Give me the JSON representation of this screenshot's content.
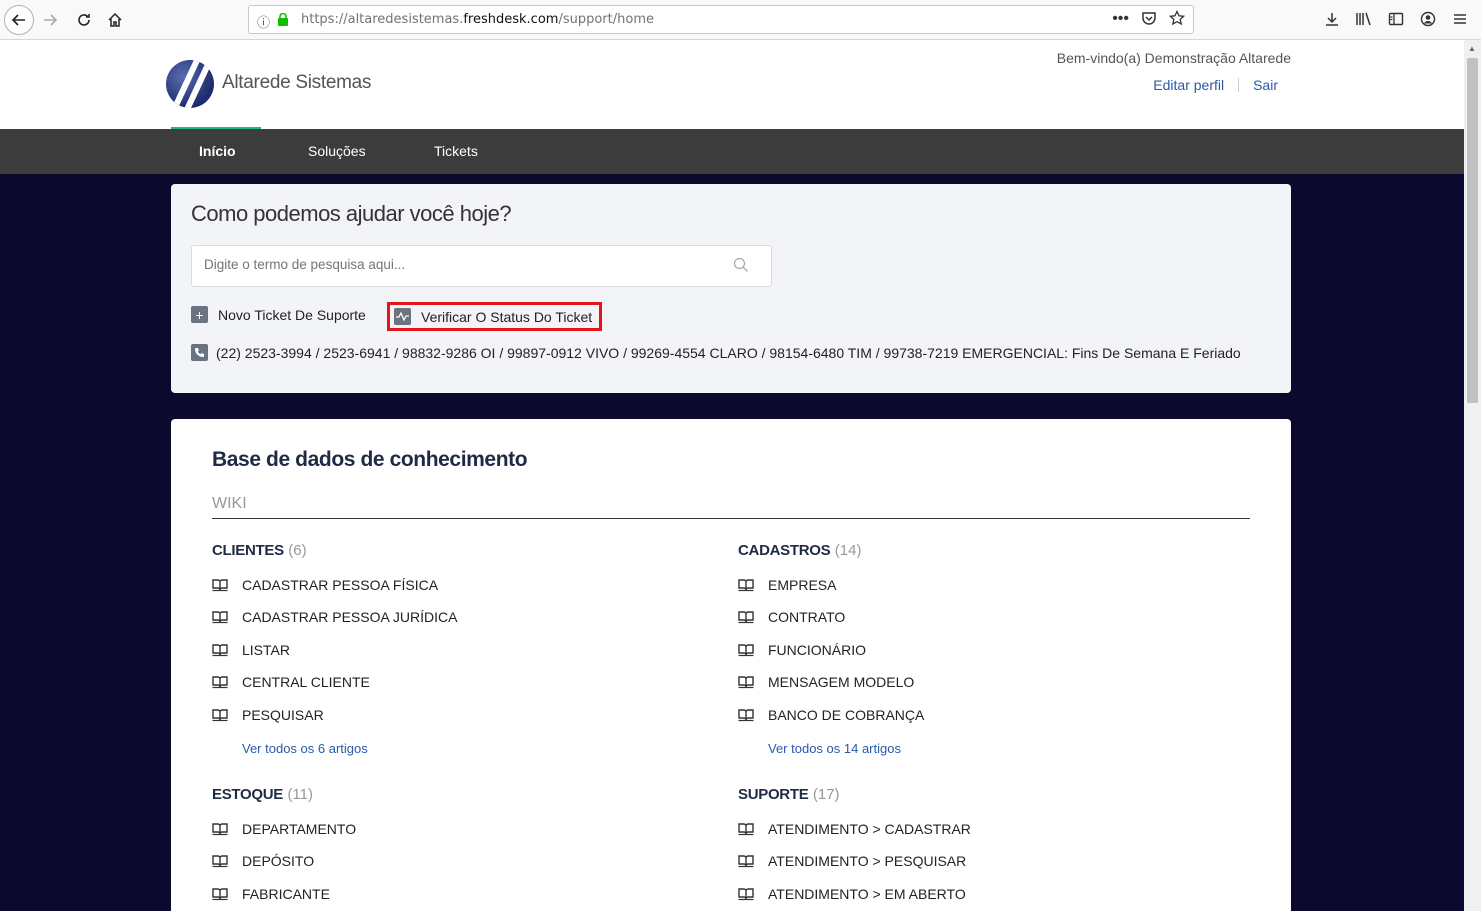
{
  "browser": {
    "url_prefix": "https://altaredesistemas.",
    "url_domain": "freshdesk.com",
    "url_path": "/support/home"
  },
  "header": {
    "logo_text": "Altarede Sistemas",
    "welcome": "Bem-vindo(a) Demonstração Altarede",
    "edit_profile": "Editar perfil",
    "logout": "Sair"
  },
  "nav": {
    "items": [
      "Início",
      "Soluções",
      "Tickets"
    ]
  },
  "help": {
    "title": "Como podemos ajudar você hoje?",
    "search_placeholder": "Digite o termo de pesquisa aqui...",
    "new_ticket": "Novo Ticket De Suporte",
    "check_status": "Verificar O Status Do Ticket",
    "phone": "(22) 2523-3994 / 2523-6941 / 98832-9286 OI / 99897-0912 VIVO / 99269-4554 CLARO / 98154-6480 TIM / 99738-7219 EMERGENCIAL: Fins De Semana E Feriado"
  },
  "kb": {
    "title": "Base de dados de conhecimento",
    "subtitle": "WIKI",
    "categories": [
      {
        "name": "CLIENTES",
        "count": "(6)",
        "articles": [
          "CADASTRAR PESSOA FÍSICA",
          "CADASTRAR PESSOA JURÍDICA",
          "LISTAR",
          "CENTRAL CLIENTE",
          "PESQUISAR"
        ],
        "view_all": "Ver todos os 6 artigos"
      },
      {
        "name": "CADASTROS",
        "count": "(14)",
        "articles": [
          "EMPRESA",
          "CONTRATO",
          "FUNCIONÁRIO",
          "MENSAGEM MODELO",
          "BANCO DE COBRANÇA"
        ],
        "view_all": "Ver todos os 14 artigos"
      },
      {
        "name": "ESTOQUE",
        "count": "(11)",
        "articles": [
          "DEPARTAMENTO",
          "DEPÓSITO",
          "FABRICANTE"
        ]
      },
      {
        "name": "SUPORTE",
        "count": "(17)",
        "articles": [
          "ATENDIMENTO > CADASTRAR",
          "ATENDIMENTO > PESQUISAR",
          "ATENDIMENTO > EM ABERTO"
        ]
      }
    ]
  }
}
